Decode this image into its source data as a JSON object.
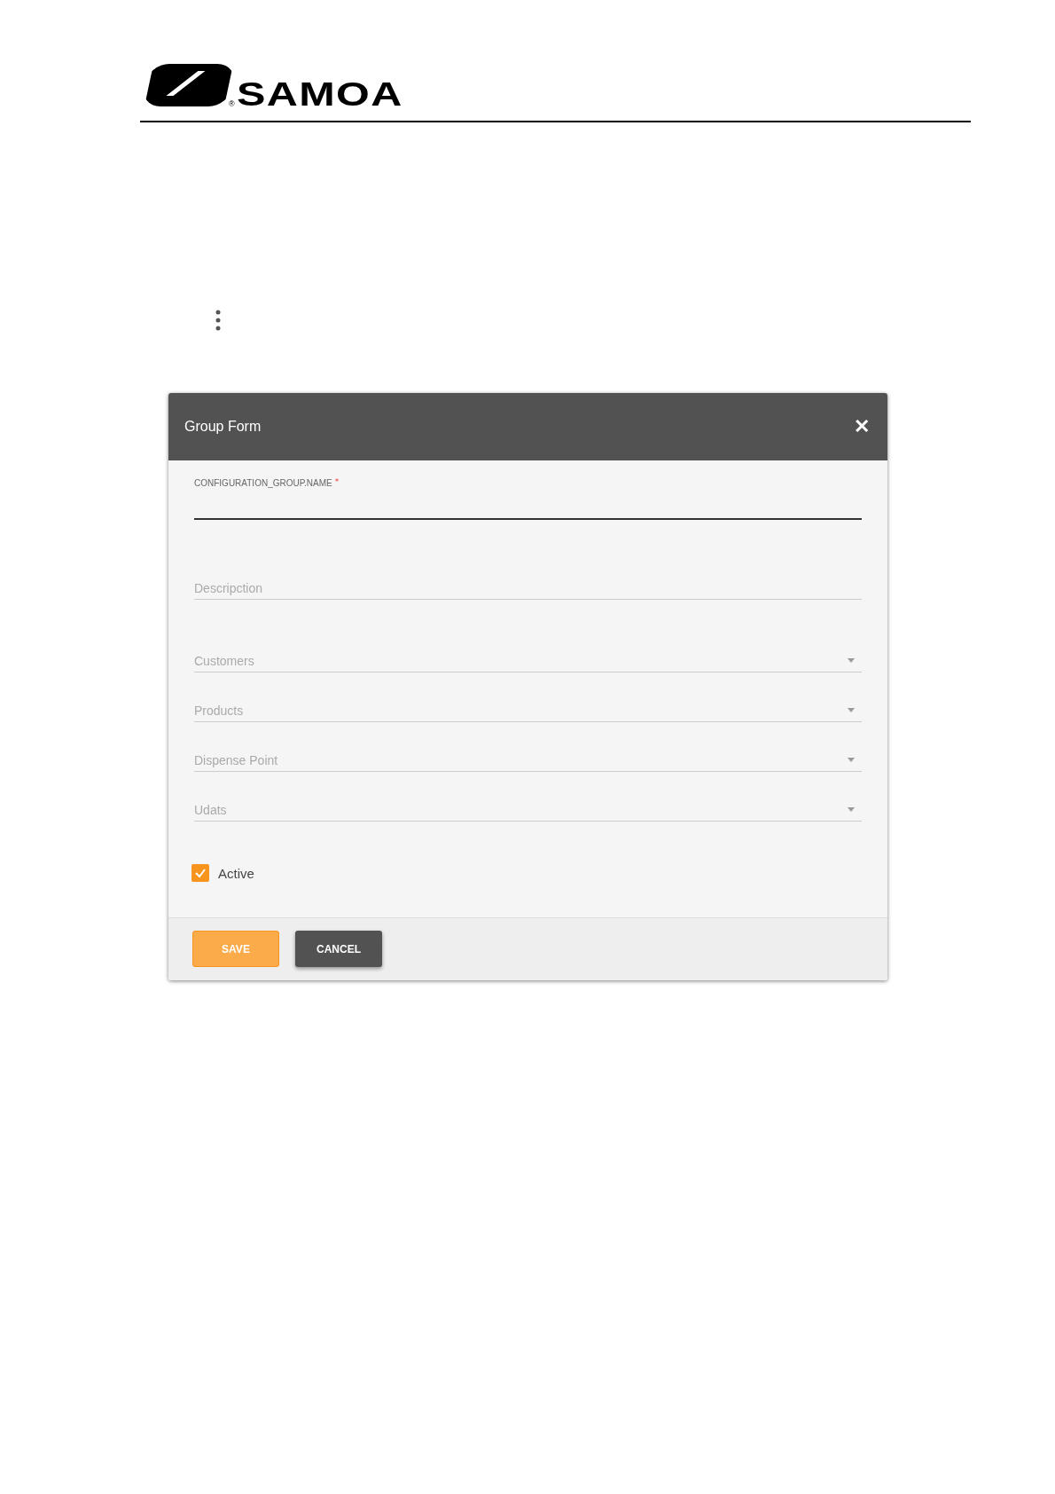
{
  "header": {
    "logo_text": "SAMOA",
    "registered_mark": "®"
  },
  "dialog": {
    "title": "Group Form",
    "close": "✕",
    "fields": [
      {
        "kind": "text",
        "label": "CONFIGURATION_GROUP.NAME",
        "required_mark": "*",
        "focused": true
      },
      {
        "kind": "text",
        "placeholder": "Descripction",
        "focused": false
      },
      {
        "kind": "select",
        "placeholder": "Customers",
        "focused": false
      },
      {
        "kind": "select",
        "placeholder": "Products",
        "focused": false
      },
      {
        "kind": "select",
        "placeholder": "Dispense Point",
        "focused": false
      },
      {
        "kind": "select",
        "placeholder": "Udats",
        "focused": false
      }
    ],
    "active": {
      "label": "Active",
      "checked": true
    },
    "buttons": [
      {
        "label": "SAVE",
        "kind": "primary"
      },
      {
        "label": "CANCEL",
        "kind": "secondary"
      }
    ]
  }
}
